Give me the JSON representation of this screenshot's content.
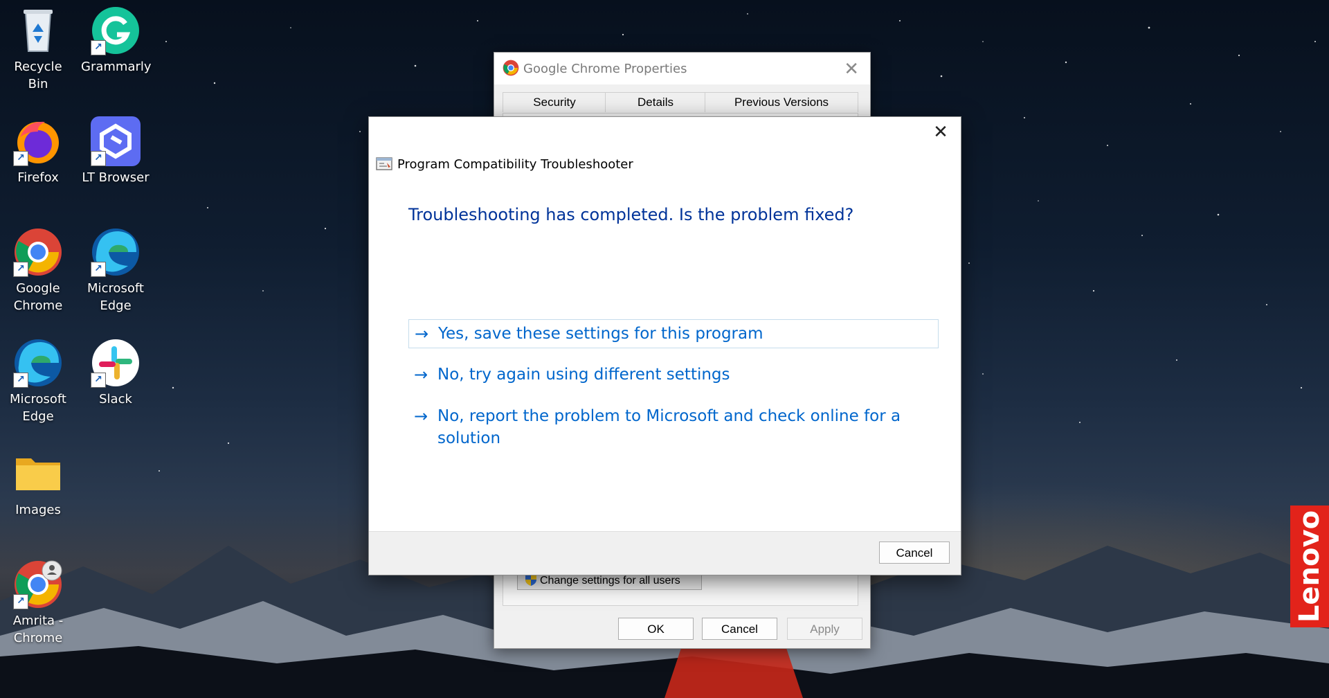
{
  "desktop_icons": [
    {
      "label": "Recycle Bin",
      "icon": "recycle-bin-icon"
    },
    {
      "label": "Grammarly",
      "icon": "grammarly-icon"
    },
    {
      "label": "Firefox",
      "icon": "firefox-icon"
    },
    {
      "label": "LT Browser",
      "icon": "lt-browser-icon"
    },
    {
      "label": "Google Chrome",
      "icon": "chrome-icon"
    },
    {
      "label": "Microsoft Edge",
      "icon": "edge-icon"
    },
    {
      "label": "Microsoft Edge",
      "icon": "edge-icon"
    },
    {
      "label": "Slack",
      "icon": "slack-icon"
    },
    {
      "label": "Images",
      "icon": "folder-icon"
    },
    {
      "label": "Amrita - Chrome",
      "icon": "chrome-profile-icon"
    }
  ],
  "brand_badge": "Lenovo",
  "properties_window": {
    "title": "Google Chrome Properties",
    "tabs": [
      "Security",
      "Details",
      "Previous Versions"
    ],
    "change_settings_label": "Change settings for all users",
    "ok_label": "OK",
    "cancel_label": "Cancel",
    "apply_label": "Apply"
  },
  "troubleshooter": {
    "header": "Program Compatibility Troubleshooter",
    "question": "Troubleshooting has completed.  Is the problem fixed?",
    "arrow_glyph": "→",
    "options": [
      "Yes, save these settings for this program",
      "No, try again using different settings",
      "No, report the problem to Microsoft and check online for a solution"
    ],
    "cancel_label": "Cancel"
  },
  "colors": {
    "question_text": "#003399",
    "option_text": "#0066cc",
    "lenovo_red": "#e2231a"
  }
}
